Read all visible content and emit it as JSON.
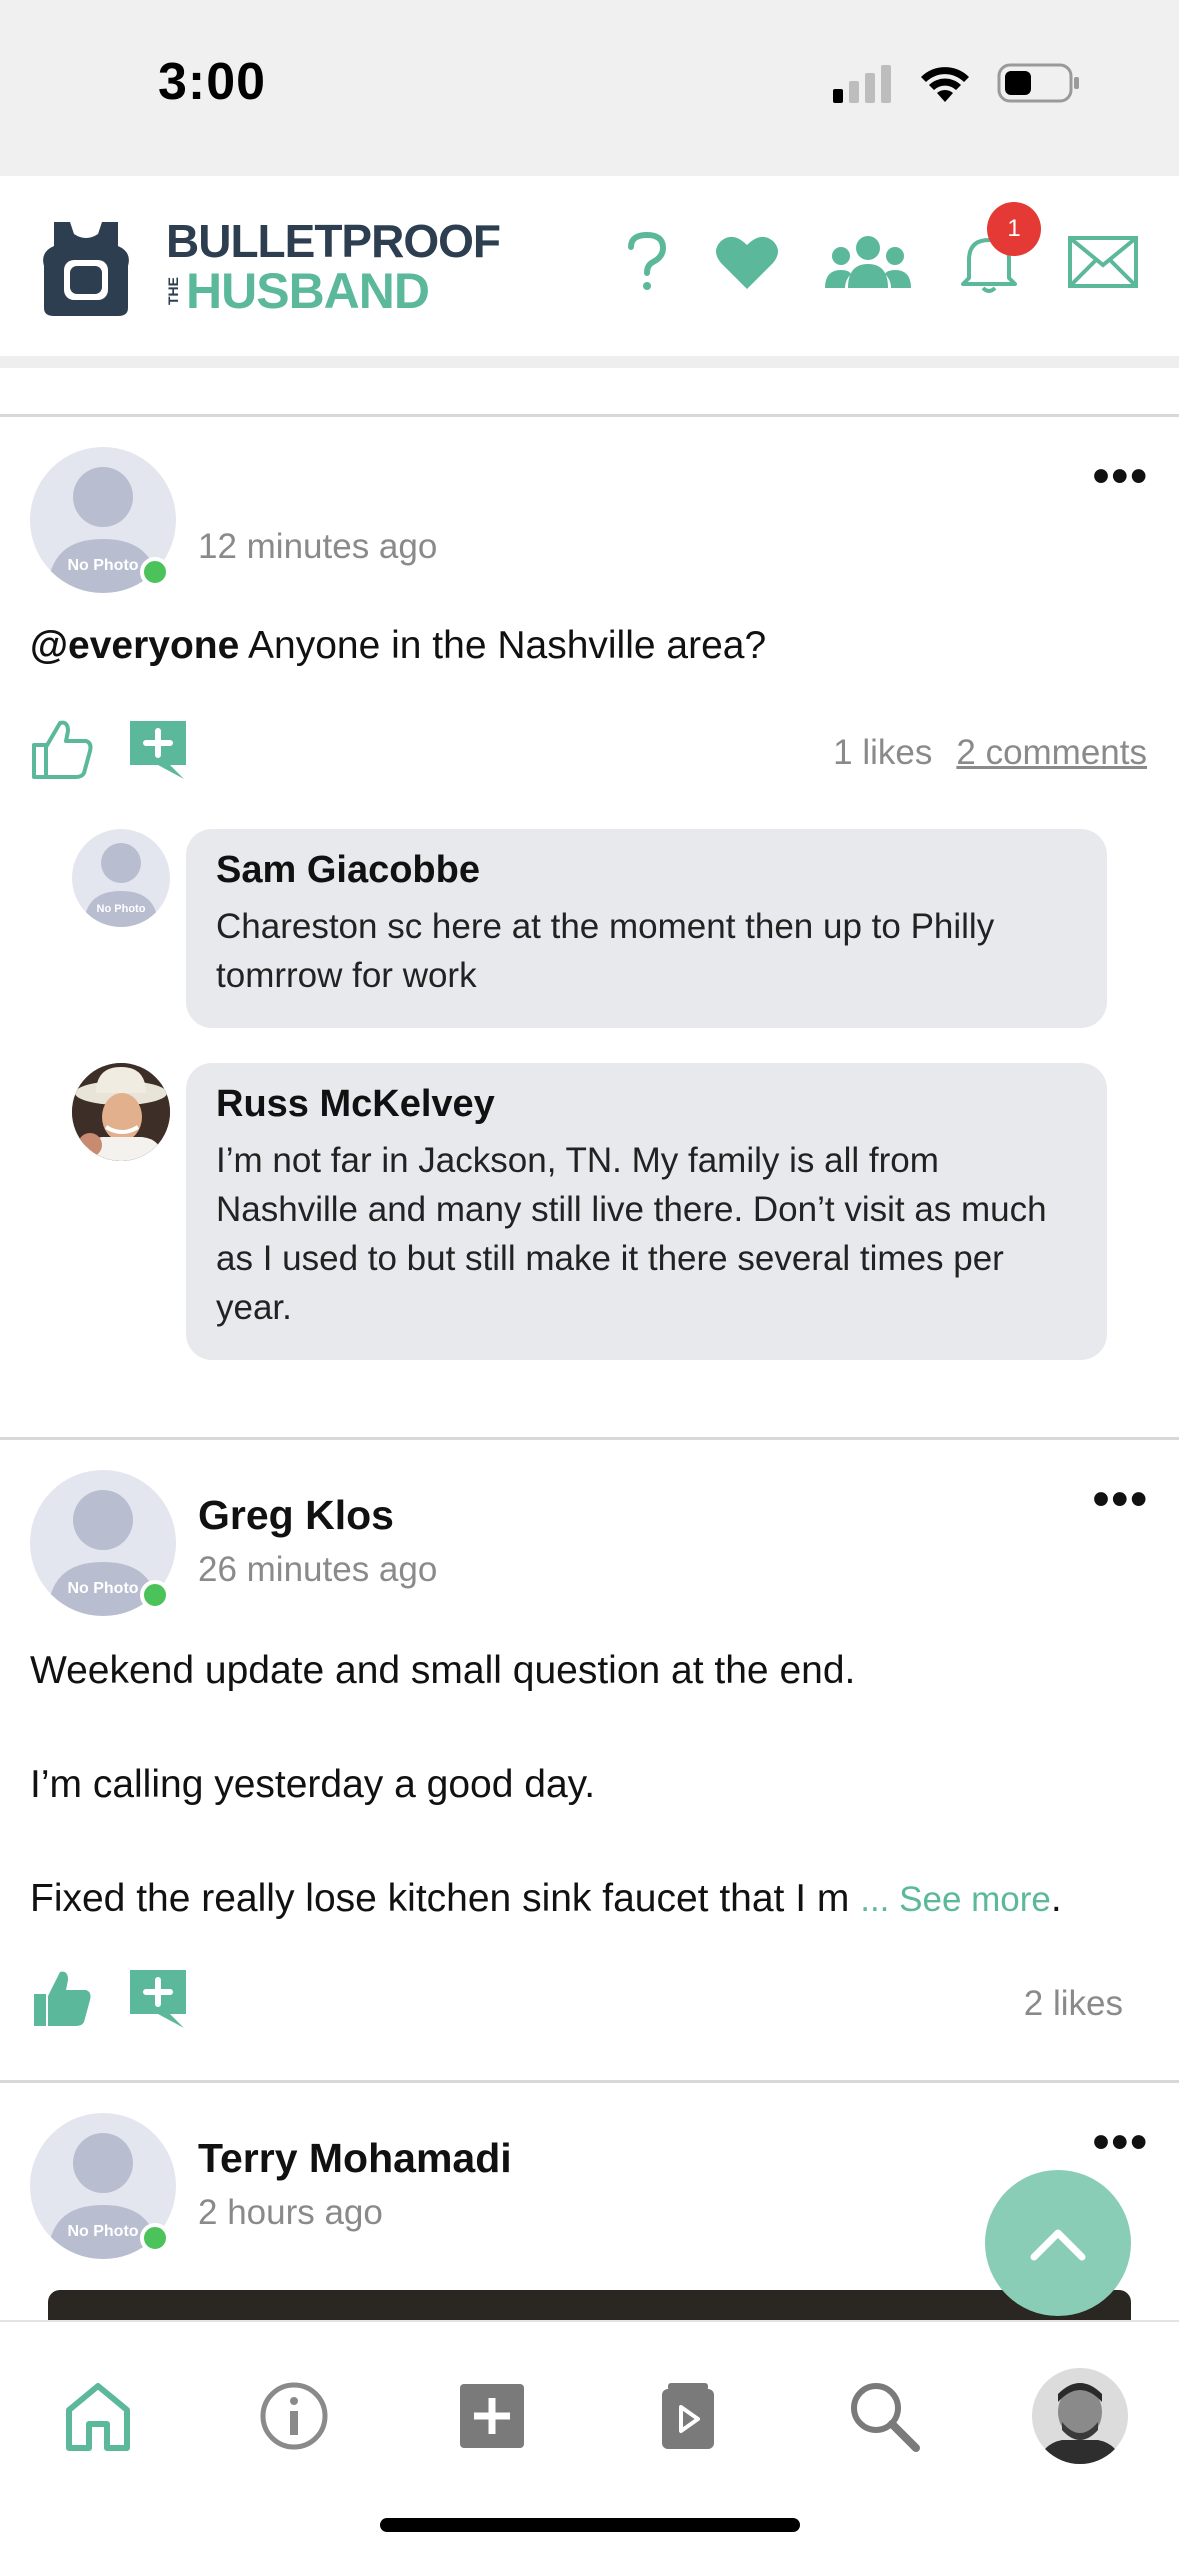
{
  "status_bar": {
    "time": "3:00"
  },
  "header": {
    "logo_line1": "BULLETPROOF",
    "logo_the": "THE",
    "logo_line2": "HUSBAND",
    "notification_count": "1"
  },
  "colors": {
    "accent": "#5cb89a",
    "navy": "#2c3e50",
    "badge": "#e53935",
    "online": "#4cc35a"
  },
  "posts": [
    {
      "time": "12 minutes ago",
      "mention": "@everyone",
      "text": " Anyone in the Nashville area?",
      "avatar_label": "No Photo",
      "likes": "1 likes",
      "comments_link": "2 comments",
      "comments": [
        {
          "author": "Sam Giacobbe",
          "text": "Chareston sc here at the moment then up to Philly tomrrow for work",
          "avatar_label": "No Photo"
        },
        {
          "author": "Russ McKelvey",
          "text": "I’m not far in Jackson, TN. My family is all from Nashville and many still live there. Don’t visit as much as I used to but still make it there several times per year."
        }
      ]
    },
    {
      "name": "Greg Klos",
      "time": "26 minutes ago",
      "avatar_label": "No Photo",
      "paragraph1": "Weekend update and small question at the end.",
      "paragraph2": "I’m calling yesterday a good day.",
      "paragraph3": "Fixed the really lose kitchen sink faucet that I m",
      "see_more": "... See more",
      "trailing": ".",
      "likes": "2 likes"
    },
    {
      "name": "Terry Mohamadi",
      "time": "2 hours ago",
      "avatar_label": "No Photo"
    }
  ],
  "tab_bar": [
    "home-icon",
    "info-icon",
    "add-icon",
    "library-icon",
    "search-icon",
    "profile-avatar"
  ]
}
